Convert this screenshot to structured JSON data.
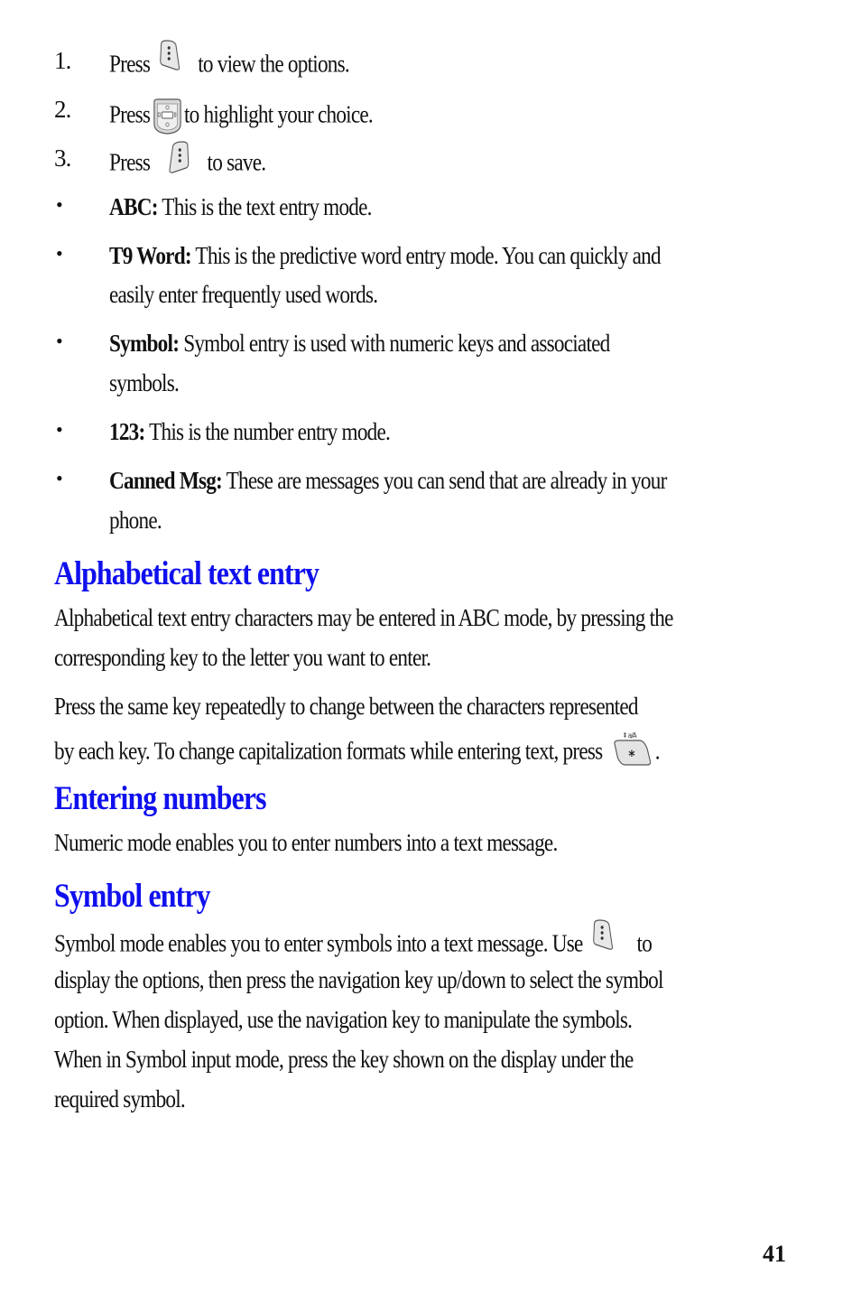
{
  "steps": [
    {
      "number": "1.",
      "before": "Press",
      "icon": "left-soft-key-icon",
      "after": "to view the options."
    },
    {
      "number": "2.",
      "before": "Press",
      "icon": "navigation-key-icon",
      "after": "to highlight your choice."
    },
    {
      "number": "3.",
      "before": "Press",
      "icon": "right-soft-key-icon",
      "after": "to save."
    }
  ],
  "modes": [
    {
      "term": "ABC:",
      "lines": [
        "This is the text entry mode."
      ]
    },
    {
      "term": "T9 Word:",
      "lines": [
        "This is the predictive word entry mode. You can quickly and",
        "easily enter frequently used words."
      ]
    },
    {
      "term": "Symbol:",
      "lines": [
        "Symbol entry is used with numeric keys and associated",
        "symbols."
      ]
    },
    {
      "term": "123:",
      "lines": [
        "This is the number entry mode."
      ]
    },
    {
      "term": "Canned Msg:",
      "lines": [
        "These are messages you can send that are already in your",
        "phone."
      ]
    }
  ],
  "sections": {
    "alphabetical": {
      "heading": "Alphabetical text entry",
      "para1": [
        "Alphabetical text entry characters may be entered in ABC mode, by pressing the",
        "corresponding key to the letter you want to enter."
      ],
      "para2_line1": "Press the same key repeatedly to change between the characters represented",
      "para2_line2_before": "by each key. To change capitalization formats while entering text, press",
      "para2_line2_icon": "star-shift-key-icon",
      "para2_line2_after": "."
    },
    "numbers": {
      "heading": "Entering numbers",
      "para": "Numeric mode enables you to enter numbers into a text message."
    },
    "symbol": {
      "heading": "Symbol entry",
      "line1_before": "Symbol mode enables you to enter symbols into a text message. Use",
      "line1_icon": "left-soft-key-icon",
      "line1_after": "to",
      "lines": [
        "display the options, then press the navigation key up/down to select the symbol",
        "option. When displayed, use the navigation key to manipulate the symbols.",
        "When in Symbol input mode, press the key shown on the display under the",
        "required symbol."
      ]
    }
  },
  "colors": {
    "heading": "#1010ee",
    "text": "#111111"
  },
  "page_number": "41"
}
